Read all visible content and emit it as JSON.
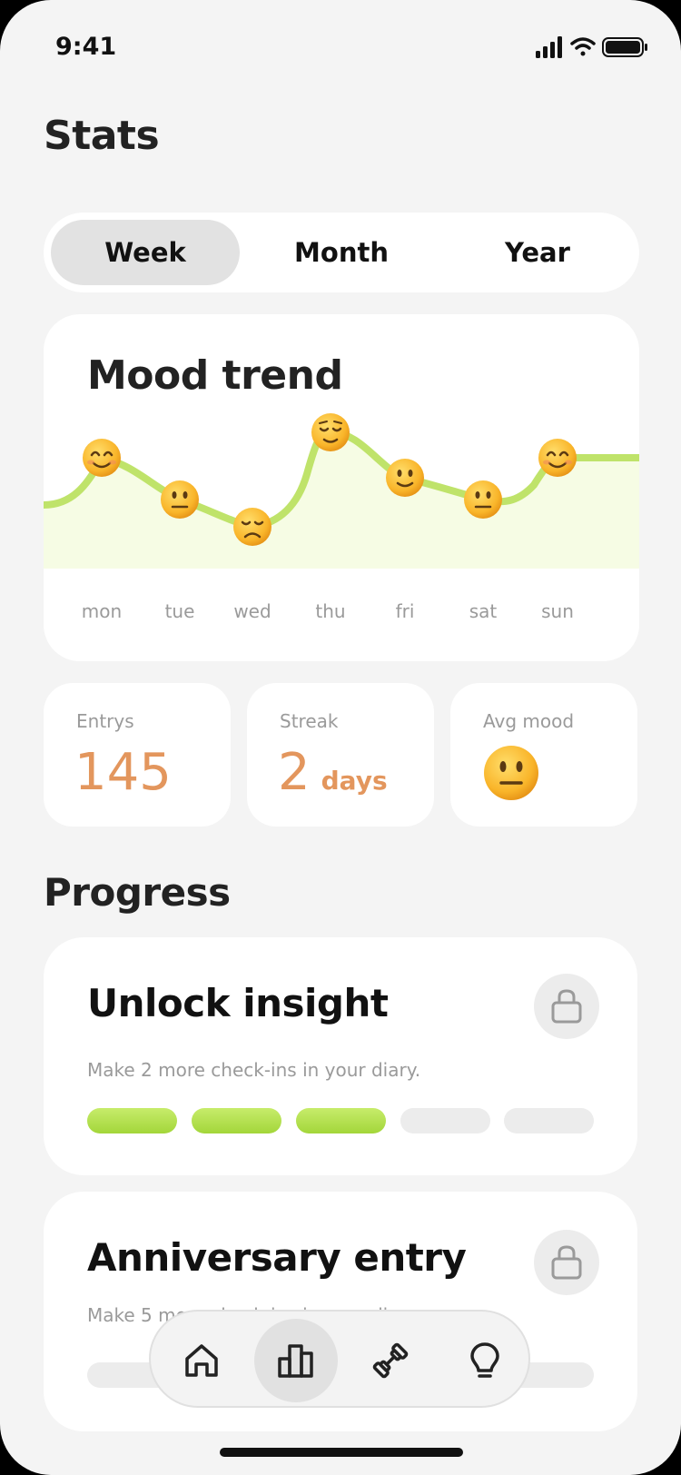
{
  "status": {
    "time": "9:41"
  },
  "page": {
    "title": "Stats"
  },
  "segments": {
    "week": "Week",
    "month": "Month",
    "year": "Year",
    "selected": "Week"
  },
  "mood": {
    "title": "Mood trend",
    "days": [
      "mon",
      "tue",
      "wed",
      "thu",
      "fri",
      "sat",
      "sun"
    ],
    "faces": [
      "smiling",
      "neutral",
      "sad",
      "relieved",
      "slightly-smiling",
      "neutral",
      "smiling"
    ]
  },
  "stats": {
    "entries_label": "Entrys",
    "entries_value": "145",
    "streak_label": "Streak",
    "streak_value": "2",
    "streak_unit": "days",
    "avg_label": "Avg mood",
    "avg_face": "neutral"
  },
  "progress": {
    "title": "Progress",
    "items": [
      {
        "title": "Unlock insight",
        "subtitle": "Make 2 more check-ins in your diary.",
        "filled": 3,
        "total": 5
      },
      {
        "title": "Anniversary entry",
        "subtitle": "Make 5 more check-ins in your diary.",
        "filled": 0,
        "total": 5
      }
    ]
  },
  "tabbar": {
    "items": [
      "home-icon",
      "stats-icon",
      "dumbbell-icon",
      "lightbulb-icon"
    ],
    "active": "stats-icon"
  },
  "colors": {
    "accent_green": "#a3d63a",
    "accent_orange": "#e3965d",
    "background": "#f4f4f4"
  }
}
